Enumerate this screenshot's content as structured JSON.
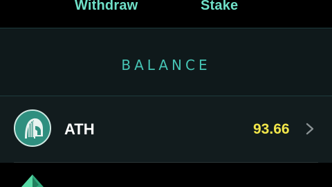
{
  "actions": {
    "withdraw_label": "Withdraw",
    "stake_label": "Stake"
  },
  "section": {
    "title": "BALANCE"
  },
  "tokens": [
    {
      "symbol": "ATH",
      "amount": "93.66",
      "icon": "spartan-helmet-icon"
    }
  ],
  "next_token": {
    "icon": "green-crystal-icon"
  },
  "colors": {
    "accent": "#6fe0c8",
    "balance_title": "#46c4b4",
    "amount": "#f2e64a",
    "panel": "#0f191b",
    "row": "#121c1e",
    "background": "#000000"
  }
}
